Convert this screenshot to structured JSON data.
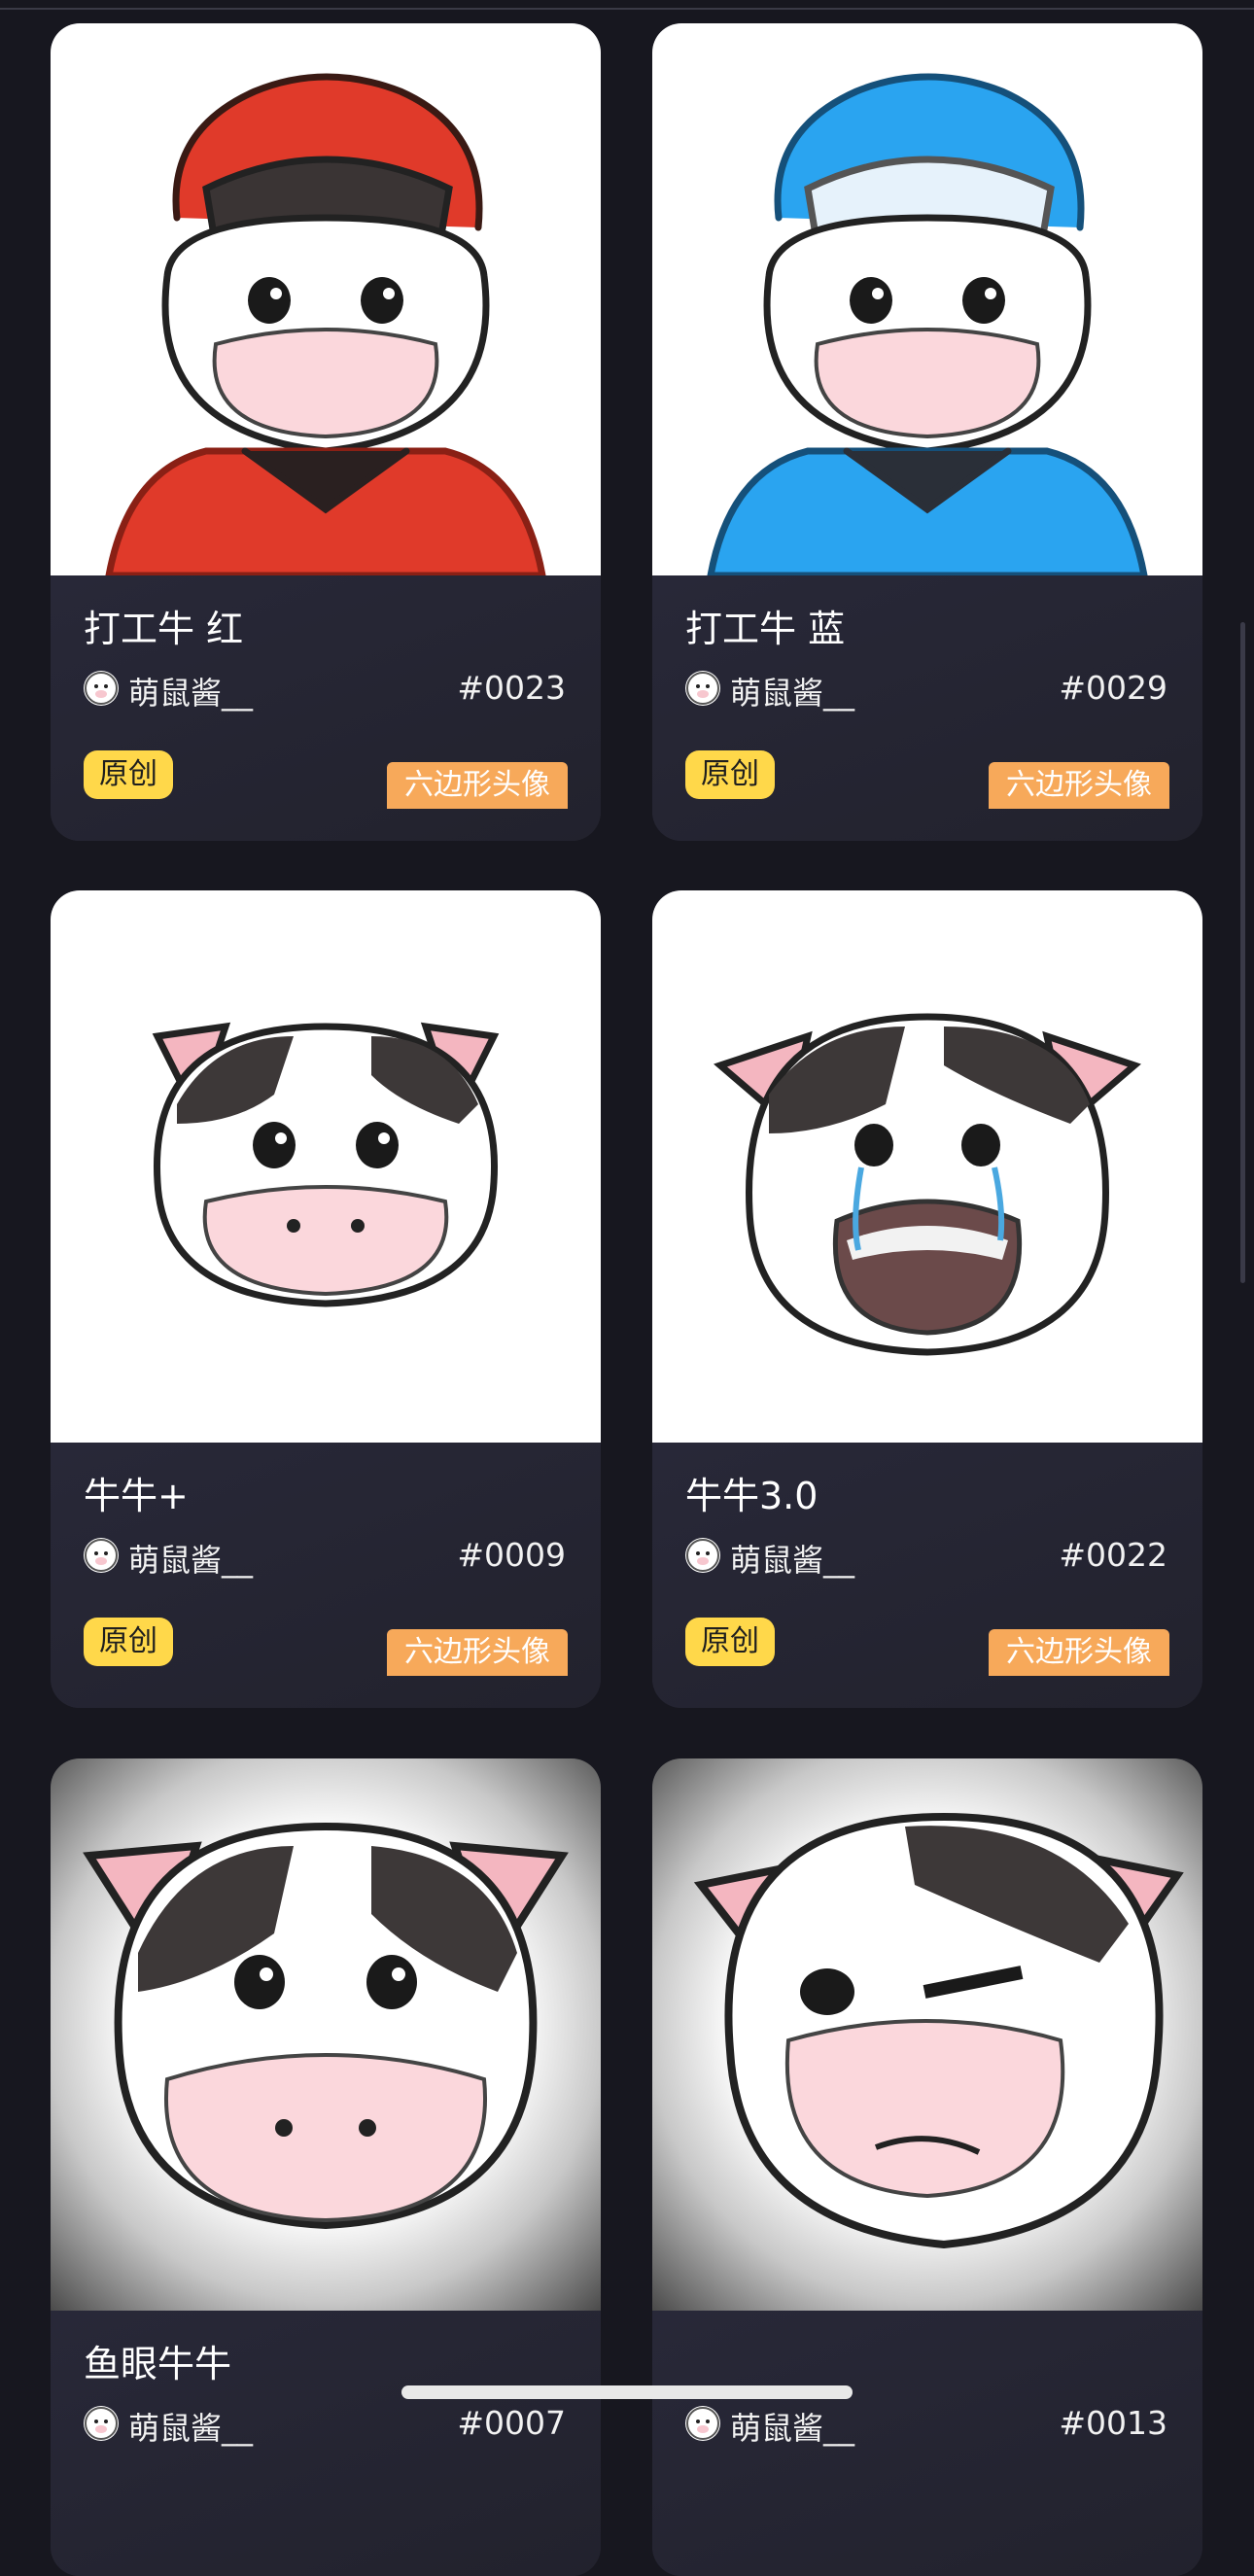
{
  "cards": [
    {
      "title": "打工牛 红",
      "author": "萌鼠酱__",
      "token": "#0023",
      "badge_original": "原创",
      "badge_type": "六边形头像",
      "art": "worker-cow-red-helmet"
    },
    {
      "title": "打工牛 蓝",
      "author": "萌鼠酱__",
      "token": "#0029",
      "badge_original": "原创",
      "badge_type": "六边形头像",
      "art": "worker-cow-blue-helmet"
    },
    {
      "title": "牛牛+",
      "author": "萌鼠酱__",
      "token": "#0009",
      "badge_original": "原创",
      "badge_type": "六边形头像",
      "art": "cow-face"
    },
    {
      "title": "牛牛3.0",
      "author": "萌鼠酱__",
      "token": "#0022",
      "badge_original": "原创",
      "badge_type": "六边形头像",
      "art": "crying-cow-face"
    },
    {
      "title": "鱼眼牛牛",
      "author": "萌鼠酱__",
      "token": "#0007",
      "art": "fisheye-cow"
    },
    {
      "title": "",
      "author": "萌鼠酱__",
      "token": "#0013",
      "art": "winking-cow"
    }
  ],
  "colors": {
    "background": "#17171f",
    "card_panel": "#24242f",
    "badge_original": "#ffd84a",
    "badge_type": "#f7a95a",
    "helmet_red": "#e03a2a",
    "helmet_blue": "#2aa4f0"
  }
}
